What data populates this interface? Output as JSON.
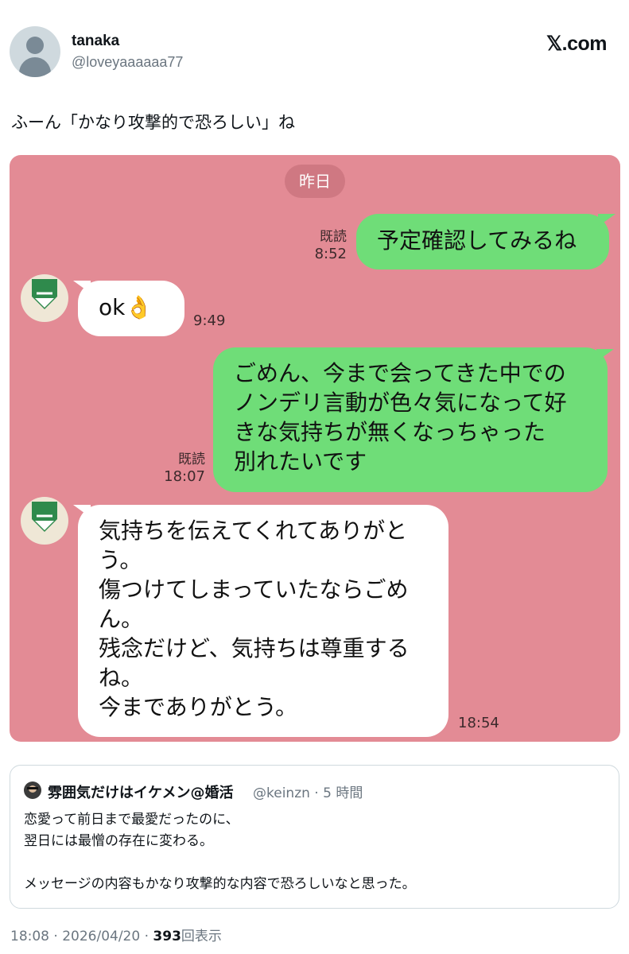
{
  "author": {
    "display_name": "tanaka",
    "handle": "@loveyaaaaaa77",
    "avatar_icon": "default-user-icon"
  },
  "brand": "𝕏.com",
  "tweet_text": "ふーん「かなり攻撃的で恐ろしい」ね",
  "chat": {
    "background": "#e38b95",
    "date_label": "昨日",
    "messages": [
      {
        "side": "right",
        "lines": [
          "予定確認してみるね"
        ],
        "read_label": "既読",
        "time": "8:52"
      },
      {
        "side": "left",
        "lines": [
          "ok👌"
        ],
        "time": "9:49"
      },
      {
        "side": "right",
        "lines": [
          "ごめん、今まで会ってきた中での",
          "ノンデリ言動が色々気になって好",
          "きな気持ちが無くなっちゃった",
          "別れたいです"
        ],
        "read_label": "既読",
        "time": "18:07"
      },
      {
        "side": "left",
        "lines": [
          "気持ちを伝えてくれてありがと",
          "う。",
          "傷つけてしまっていたならごめ",
          "ん。",
          "残念だけど、気持ちは尊重する",
          "ね。",
          "今までありがとう。"
        ],
        "time": "18:54"
      }
    ]
  },
  "quote": {
    "display_name": "雰囲気だけはイケメン@婚活",
    "handle_time": "@keinzn · 5 時間",
    "lines": [
      "恋愛って前日まで最愛だったのに、",
      "翌日には最憎の存在に変わる。",
      "",
      "メッセージの内容もかなり攻撃的な内容で恐ろしいなと思った。"
    ]
  },
  "footer": {
    "timestamp": "18:08 · 2026/04/20 · ",
    "views_count": "393",
    "views_label": "回表示"
  }
}
